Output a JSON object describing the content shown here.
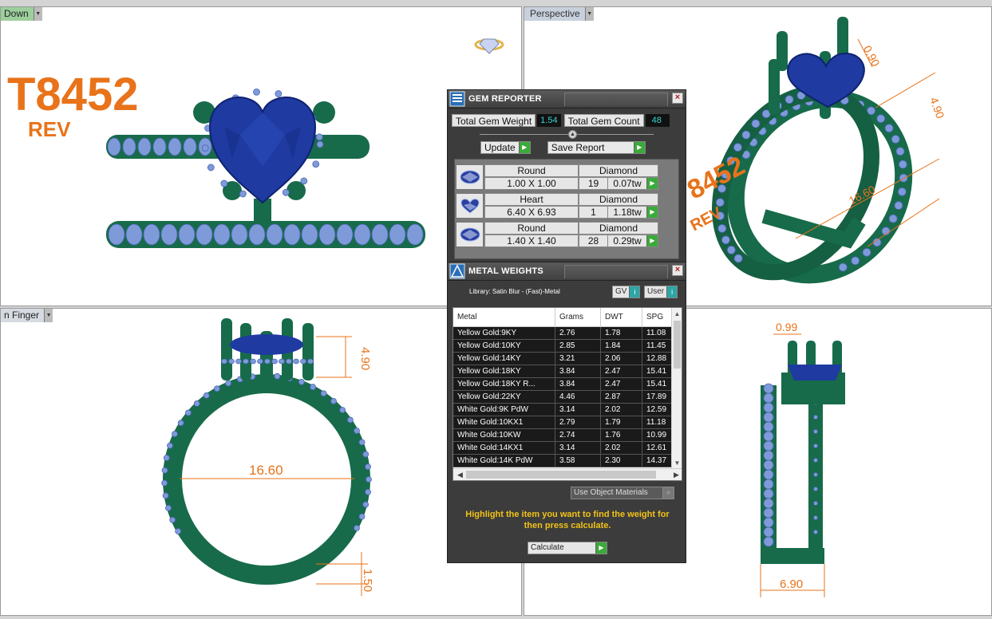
{
  "viewports": {
    "top_left": {
      "label": "Down"
    },
    "top_right": {
      "label": "Perspective"
    },
    "bottom_left": {
      "label": "n Finger"
    }
  },
  "model": {
    "code": "T8452",
    "suffix": "REV",
    "code_partial": "8452"
  },
  "dimensions": {
    "tr_top": "0.90",
    "tr_height": "4.90",
    "tr_diameter": "16.60",
    "bl_height": "4.90",
    "bl_diameter": "16.60",
    "bl_band": "1.50",
    "br_top": "0.99",
    "br_width": "6.90"
  },
  "colors": {
    "metal_green": "#176b4a",
    "gem_blue": "#1f3aa0",
    "accent_stone": "#7f9ad8",
    "dimension_orange": "#e8731a"
  },
  "gem_reporter": {
    "title": "GEM REPORTER",
    "total_weight_label": "Total Gem Weight",
    "total_weight_value": "1.54",
    "total_count_label": "Total Gem Count",
    "total_count_value": "48",
    "update_label": "Update",
    "save_report_label": "Save Report",
    "gems": [
      {
        "shape": "Round",
        "material": "Diamond",
        "size": "1.00 X 1.00",
        "count": "19",
        "weight": "0.07tw"
      },
      {
        "shape": "Heart",
        "material": "Diamond",
        "size": "6.40 X 6.93",
        "count": "1",
        "weight": "1.18tw"
      },
      {
        "shape": "Round",
        "material": "Diamond",
        "size": "1.40 X 1.40",
        "count": "28",
        "weight": "0.29tw"
      }
    ]
  },
  "metal_weights": {
    "title": "METAL WEIGHTS",
    "library": "Library: Satin Blur - (Fast)-Metal",
    "gv_label": "GV",
    "user_label": "User",
    "columns": [
      "Metal",
      "Grams",
      "DWT",
      "SPG"
    ],
    "rows": [
      {
        "metal": "Yellow Gold:9KY",
        "grams": "2.76",
        "dwt": "1.78",
        "spg": "11.08"
      },
      {
        "metal": "Yellow Gold:10KY",
        "grams": "2.85",
        "dwt": "1.84",
        "spg": "11.45"
      },
      {
        "metal": "Yellow Gold:14KY",
        "grams": "3.21",
        "dwt": "2.06",
        "spg": "12.88"
      },
      {
        "metal": "Yellow Gold:18KY",
        "grams": "3.84",
        "dwt": "2.47",
        "spg": "15.41"
      },
      {
        "metal": "Yellow Gold:18KY R...",
        "grams": "3.84",
        "dwt": "2.47",
        "spg": "15.41"
      },
      {
        "metal": "Yellow Gold:22KY",
        "grams": "4.46",
        "dwt": "2.87",
        "spg": "17.89"
      },
      {
        "metal": "White Gold:9K PdW",
        "grams": "3.14",
        "dwt": "2.02",
        "spg": "12.59"
      },
      {
        "metal": "White Gold:10KX1",
        "grams": "2.79",
        "dwt": "1.79",
        "spg": "11.18"
      },
      {
        "metal": "White Gold:10KW",
        "grams": "2.74",
        "dwt": "1.76",
        "spg": "10.99"
      },
      {
        "metal": "White Gold:14KX1",
        "grams": "3.14",
        "dwt": "2.02",
        "spg": "12.61"
      },
      {
        "metal": "White Gold:14K PdW",
        "grams": "3.58",
        "dwt": "2.30",
        "spg": "14.37"
      }
    ],
    "use_object_materials": "Use Object Materials",
    "hint": "Highlight the item you want to find the weight for then press calculate.",
    "calculate_label": "Calculate"
  }
}
